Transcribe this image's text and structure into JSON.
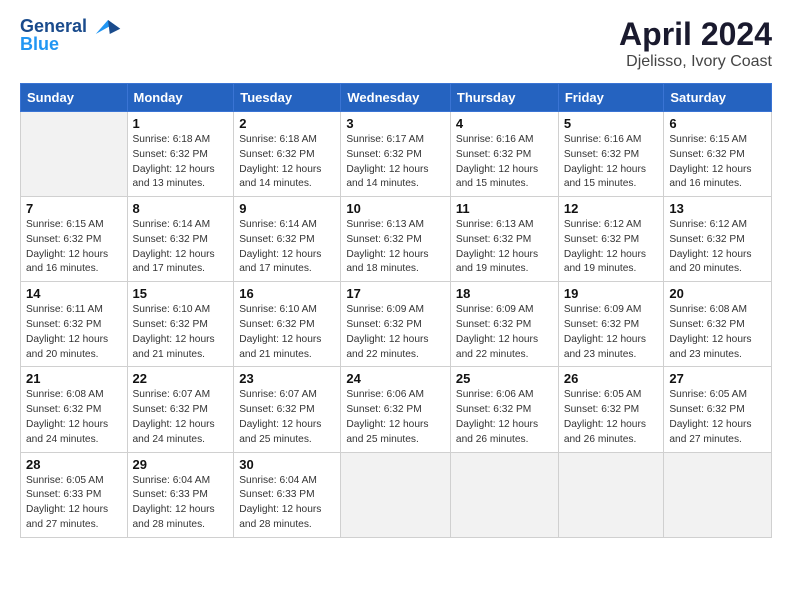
{
  "header": {
    "logo_line1": "General",
    "logo_line2": "Blue",
    "main_title": "April 2024",
    "subtitle": "Djelisso, Ivory Coast"
  },
  "weekdays": [
    "Sunday",
    "Monday",
    "Tuesday",
    "Wednesday",
    "Thursday",
    "Friday",
    "Saturday"
  ],
  "weeks": [
    [
      {
        "day": "",
        "info": ""
      },
      {
        "day": "1",
        "info": "Sunrise: 6:18 AM\nSunset: 6:32 PM\nDaylight: 12 hours\nand 13 minutes."
      },
      {
        "day": "2",
        "info": "Sunrise: 6:18 AM\nSunset: 6:32 PM\nDaylight: 12 hours\nand 14 minutes."
      },
      {
        "day": "3",
        "info": "Sunrise: 6:17 AM\nSunset: 6:32 PM\nDaylight: 12 hours\nand 14 minutes."
      },
      {
        "day": "4",
        "info": "Sunrise: 6:16 AM\nSunset: 6:32 PM\nDaylight: 12 hours\nand 15 minutes."
      },
      {
        "day": "5",
        "info": "Sunrise: 6:16 AM\nSunset: 6:32 PM\nDaylight: 12 hours\nand 15 minutes."
      },
      {
        "day": "6",
        "info": "Sunrise: 6:15 AM\nSunset: 6:32 PM\nDaylight: 12 hours\nand 16 minutes."
      }
    ],
    [
      {
        "day": "7",
        "info": "Sunrise: 6:15 AM\nSunset: 6:32 PM\nDaylight: 12 hours\nand 16 minutes."
      },
      {
        "day": "8",
        "info": "Sunrise: 6:14 AM\nSunset: 6:32 PM\nDaylight: 12 hours\nand 17 minutes."
      },
      {
        "day": "9",
        "info": "Sunrise: 6:14 AM\nSunset: 6:32 PM\nDaylight: 12 hours\nand 17 minutes."
      },
      {
        "day": "10",
        "info": "Sunrise: 6:13 AM\nSunset: 6:32 PM\nDaylight: 12 hours\nand 18 minutes."
      },
      {
        "day": "11",
        "info": "Sunrise: 6:13 AM\nSunset: 6:32 PM\nDaylight: 12 hours\nand 19 minutes."
      },
      {
        "day": "12",
        "info": "Sunrise: 6:12 AM\nSunset: 6:32 PM\nDaylight: 12 hours\nand 19 minutes."
      },
      {
        "day": "13",
        "info": "Sunrise: 6:12 AM\nSunset: 6:32 PM\nDaylight: 12 hours\nand 20 minutes."
      }
    ],
    [
      {
        "day": "14",
        "info": "Sunrise: 6:11 AM\nSunset: 6:32 PM\nDaylight: 12 hours\nand 20 minutes."
      },
      {
        "day": "15",
        "info": "Sunrise: 6:10 AM\nSunset: 6:32 PM\nDaylight: 12 hours\nand 21 minutes."
      },
      {
        "day": "16",
        "info": "Sunrise: 6:10 AM\nSunset: 6:32 PM\nDaylight: 12 hours\nand 21 minutes."
      },
      {
        "day": "17",
        "info": "Sunrise: 6:09 AM\nSunset: 6:32 PM\nDaylight: 12 hours\nand 22 minutes."
      },
      {
        "day": "18",
        "info": "Sunrise: 6:09 AM\nSunset: 6:32 PM\nDaylight: 12 hours\nand 22 minutes."
      },
      {
        "day": "19",
        "info": "Sunrise: 6:09 AM\nSunset: 6:32 PM\nDaylight: 12 hours\nand 23 minutes."
      },
      {
        "day": "20",
        "info": "Sunrise: 6:08 AM\nSunset: 6:32 PM\nDaylight: 12 hours\nand 23 minutes."
      }
    ],
    [
      {
        "day": "21",
        "info": "Sunrise: 6:08 AM\nSunset: 6:32 PM\nDaylight: 12 hours\nand 24 minutes."
      },
      {
        "day": "22",
        "info": "Sunrise: 6:07 AM\nSunset: 6:32 PM\nDaylight: 12 hours\nand 24 minutes."
      },
      {
        "day": "23",
        "info": "Sunrise: 6:07 AM\nSunset: 6:32 PM\nDaylight: 12 hours\nand 25 minutes."
      },
      {
        "day": "24",
        "info": "Sunrise: 6:06 AM\nSunset: 6:32 PM\nDaylight: 12 hours\nand 25 minutes."
      },
      {
        "day": "25",
        "info": "Sunrise: 6:06 AM\nSunset: 6:32 PM\nDaylight: 12 hours\nand 26 minutes."
      },
      {
        "day": "26",
        "info": "Sunrise: 6:05 AM\nSunset: 6:32 PM\nDaylight: 12 hours\nand 26 minutes."
      },
      {
        "day": "27",
        "info": "Sunrise: 6:05 AM\nSunset: 6:32 PM\nDaylight: 12 hours\nand 27 minutes."
      }
    ],
    [
      {
        "day": "28",
        "info": "Sunrise: 6:05 AM\nSunset: 6:33 PM\nDaylight: 12 hours\nand 27 minutes."
      },
      {
        "day": "29",
        "info": "Sunrise: 6:04 AM\nSunset: 6:33 PM\nDaylight: 12 hours\nand 28 minutes."
      },
      {
        "day": "30",
        "info": "Sunrise: 6:04 AM\nSunset: 6:33 PM\nDaylight: 12 hours\nand 28 minutes."
      },
      {
        "day": "",
        "info": ""
      },
      {
        "day": "",
        "info": ""
      },
      {
        "day": "",
        "info": ""
      },
      {
        "day": "",
        "info": ""
      }
    ]
  ]
}
